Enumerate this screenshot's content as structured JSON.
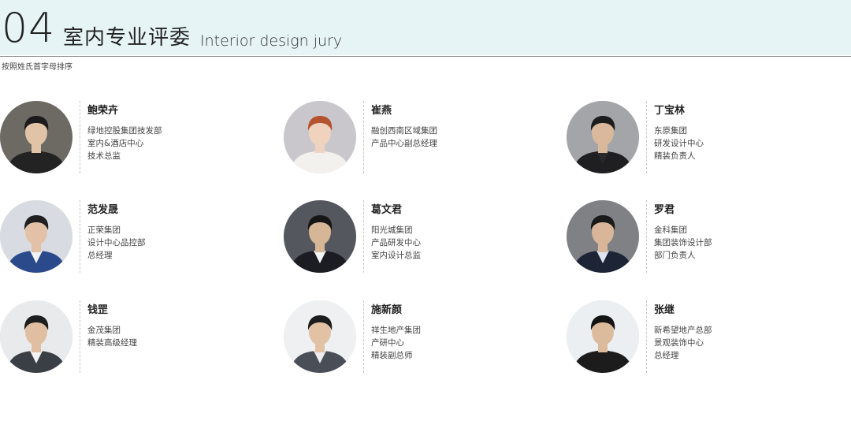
{
  "header": {
    "number": "04",
    "title_cn": "室内专业评委",
    "title_en": "Interior design jury",
    "sort_note": "按照姓氏首字母排序"
  },
  "jurors": [
    {
      "name": "鲍荣卉",
      "lines": [
        "绿地控股集团技发部",
        "室内&酒店中心",
        "技术总监"
      ],
      "avatar": {
        "bg": "#6c6a63",
        "skin": "#e1c4a8",
        "hair": "#1b1b1b",
        "cloth": "#232323",
        "shirt": "#232323"
      }
    },
    {
      "name": "崔燕",
      "lines": [
        "融创西南区域集团",
        "产品中心副总经理"
      ],
      "avatar": {
        "bg": "#c9c7cc",
        "skin": "#efd3bf",
        "hair": "#b5532e",
        "cloth": "#f3f1ee",
        "shirt": "#f3f1ee"
      }
    },
    {
      "name": "丁宝林",
      "lines": [
        "东原集团",
        "研发设计中心",
        "精装负责人"
      ],
      "avatar": {
        "bg": "#a3a5a8",
        "skin": "#d9b89c",
        "hair": "#1d1d1d",
        "cloth": "#1f1f22",
        "shirt": "#2a2a2e"
      }
    },
    {
      "name": "范发晟",
      "lines": [
        "正荣集团",
        "设计中心品控部",
        "总经理"
      ],
      "avatar": {
        "bg": "#d8dbe2",
        "skin": "#e2c1a6",
        "hair": "#202020",
        "cloth": "#2b4a8c",
        "shirt": "#f2f3f5"
      }
    },
    {
      "name": "葛文君",
      "lines": [
        "阳光城集团",
        "产品研发中心",
        "室内设计总监"
      ],
      "avatar": {
        "bg": "#54575d",
        "skin": "#d7b597",
        "hair": "#161616",
        "cloth": "#1b1d22",
        "shirt": "#f4f4f4"
      }
    },
    {
      "name": "罗君",
      "lines": [
        "金科集团",
        "集团装饰设计部",
        "部门负责人"
      ],
      "avatar": {
        "bg": "#7f8185",
        "skin": "#d9b699",
        "hair": "#1a1a1a",
        "cloth": "#1c2435",
        "shirt": "#dfe4ee"
      }
    },
    {
      "name": "钱罡",
      "lines": [
        "金茂集团",
        "精装高级经理"
      ],
      "avatar": {
        "bg": "#e9eaec",
        "skin": "#e0bea1",
        "hair": "#1e1e1e",
        "cloth": "#3a3e45",
        "shirt": "#f3f3f3"
      }
    },
    {
      "name": "施新颜",
      "lines": [
        "祥生地产集团",
        "产研中心",
        "精装副总师"
      ],
      "avatar": {
        "bg": "#eef0f2",
        "skin": "#e2c1a5",
        "hair": "#1c1c1c",
        "cloth": "#4a4e57",
        "shirt": "#ececec"
      }
    },
    {
      "name": "张继",
      "lines": [
        "新希望地产总部",
        "景观装饰中心",
        "总经理"
      ],
      "avatar": {
        "bg": "#eceff1",
        "skin": "#dcbb9d",
        "hair": "#141414",
        "cloth": "#1c1c1c",
        "shirt": "#1c1c1c"
      }
    }
  ]
}
